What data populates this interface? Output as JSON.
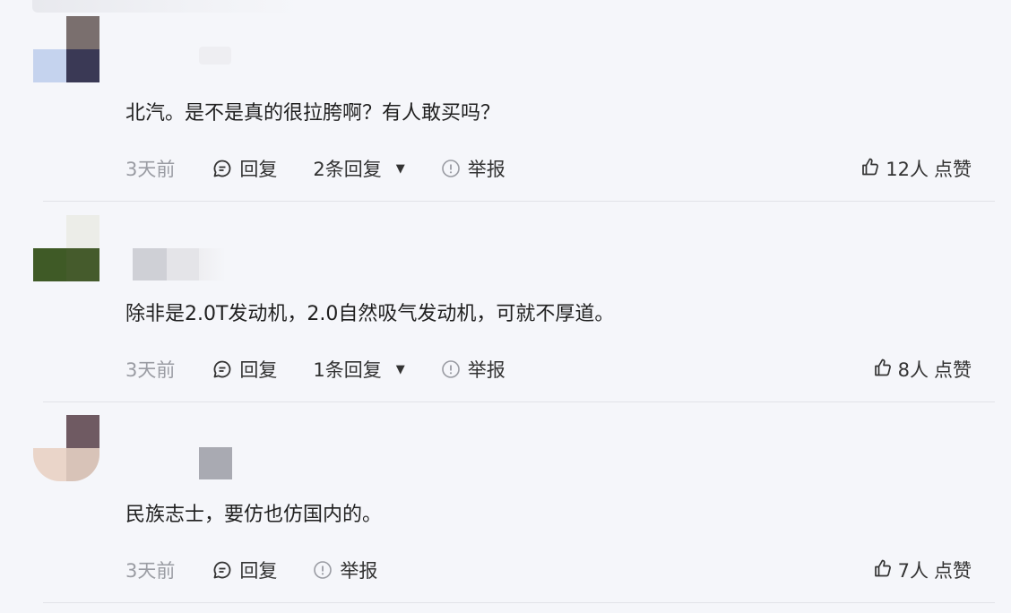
{
  "comments": [
    {
      "avatar_colors": [
        "#f5f6fa",
        "#7a6f6e",
        "#c5d3ee",
        "#3a3955"
      ],
      "nickname_colors": [
        "#f2f2f4",
        "#e4e4e8"
      ],
      "text": "北汽。是不是真的很拉胯啊？有人敢买吗？",
      "time": "3天前",
      "reply_label": "回复",
      "replies_label": "2条回复",
      "report_label": "举报",
      "like_count": "12人",
      "like_label": "点赞"
    },
    {
      "avatar_colors": [
        "#f5f6fa",
        "#ecede8",
        "#3f5a26",
        "#455b2c"
      ],
      "nickname_colors": [
        "#cfd0d6",
        "#e4e4e8",
        "#eeeef1"
      ],
      "text": "除非是2.0T发动机，2.0自然吸气发动机，可就不厚道。",
      "time": "3天前",
      "reply_label": "回复",
      "replies_label": "1条回复",
      "report_label": "举报",
      "like_count": "8人",
      "like_label": "点赞"
    },
    {
      "avatar_colors": [
        "#f5f6fa",
        "#6f5a62",
        "#ead5c9",
        "#d8c3b8"
      ],
      "nickname_colors": [
        "#a9aab2"
      ],
      "text": "民族志士，要仿也仿国内的。",
      "time": "3天前",
      "reply_label": "回复",
      "report_label": "举报",
      "like_count": "7人",
      "like_label": "点赞"
    }
  ]
}
